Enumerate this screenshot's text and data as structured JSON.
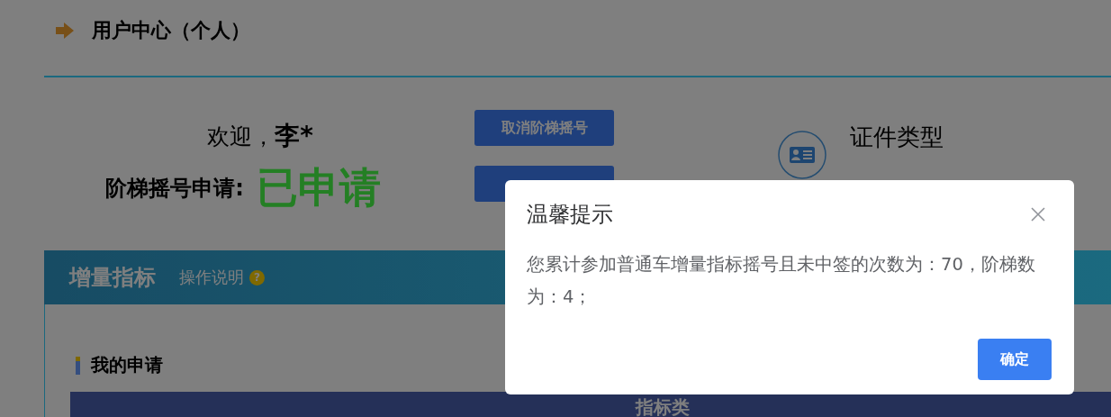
{
  "header": {
    "title": "用户中心（个人）"
  },
  "welcome": {
    "greeting": "欢迎，",
    "name": "李*",
    "status_label": "阶梯摇号申请:",
    "status_value": "已申请"
  },
  "actions": [
    "取消阶梯摇号"
  ],
  "certificate": {
    "label": "证件类型"
  },
  "section": {
    "title": "增量指标",
    "help_link": "操作说明",
    "help_mark": "?"
  },
  "my_applications": {
    "title": "我的申请",
    "table": {
      "columns": [
        "指标类"
      ]
    }
  },
  "dialog": {
    "title": "温馨提示",
    "message": "您累计参加普通车增量指标摇号且未中签的次数为：70，阶梯数为：4；",
    "buttons": [
      "确定"
    ]
  }
}
